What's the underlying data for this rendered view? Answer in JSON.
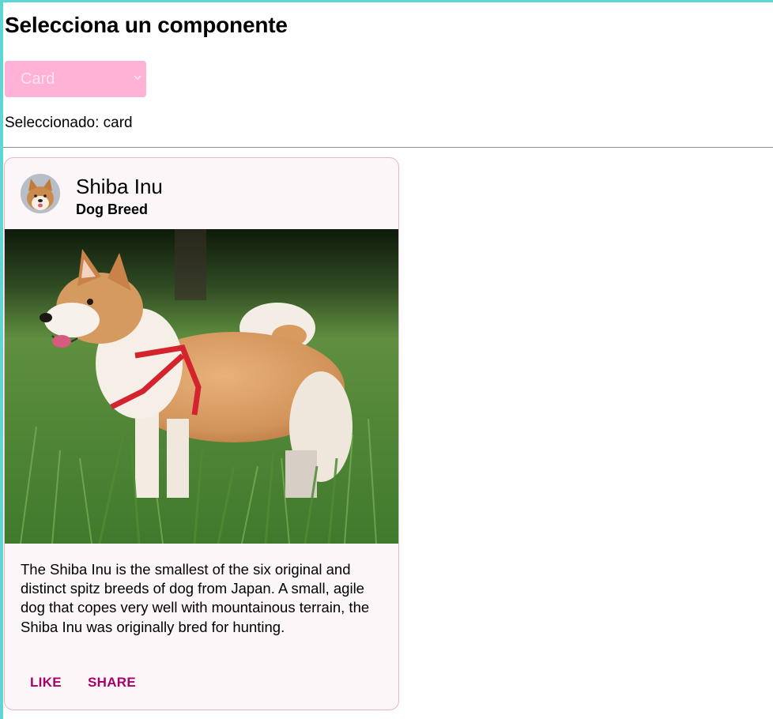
{
  "page": {
    "title": "Selecciona un componente"
  },
  "selector": {
    "value": "Card",
    "icon": "chevron-down-icon"
  },
  "selected": {
    "text": "Seleccionado: card"
  },
  "card": {
    "title": "Shiba Inu",
    "subtitle": "Dog Breed",
    "body": "The Shiba Inu is the smallest of the six original and distinct spitz breeds of dog from Japan. A small, agile dog that copes very well with mountainous terrain, the Shiba Inu was originally bred for hunting.",
    "actions": {
      "like": "LIKE",
      "share": "SHARE"
    },
    "colors": {
      "background": "#fdf6f8",
      "border": "#e6b6cc",
      "action": "#a8006a"
    }
  },
  "colors": {
    "accent_frame": "#5ed6d2",
    "select_background": "#ffb1d6",
    "select_text": "#ffe6f2"
  }
}
